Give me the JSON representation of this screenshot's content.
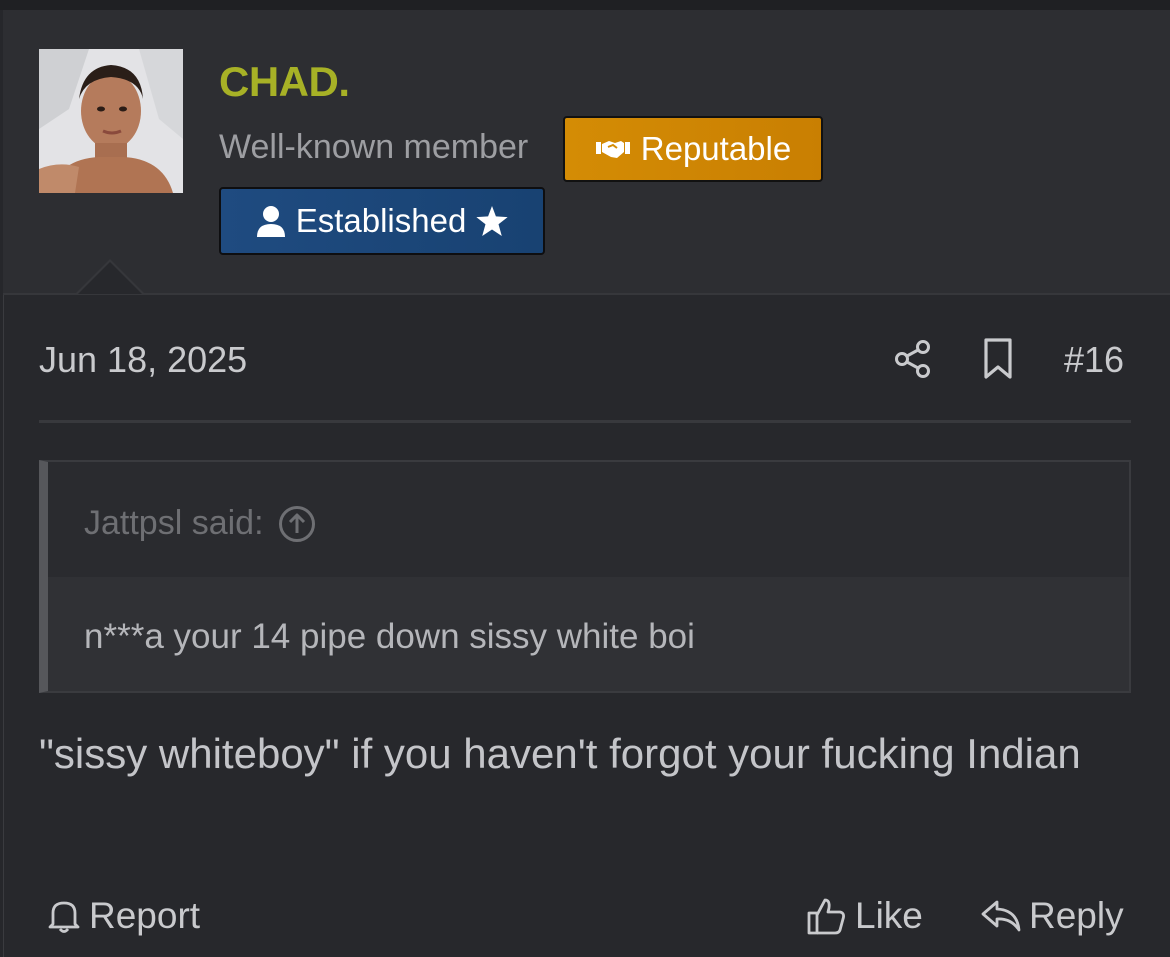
{
  "user": {
    "name": "CHAD.",
    "title": "Well-known member",
    "badges": [
      {
        "label": "Reputable",
        "icon": "handshake-icon",
        "color": "#d48c05"
      },
      {
        "label": "Established",
        "icon": "user-icon",
        "suffix_icon": "star-icon",
        "color": "#1f4b80"
      }
    ],
    "name_color": "#a7b126"
  },
  "post": {
    "date": "Jun 18, 2025",
    "number": "#16",
    "icons": [
      "share-icon",
      "bookmark-icon"
    ],
    "quote": {
      "author_label": "Jattpsl said:",
      "author_icon": "arrow-up-circle-icon",
      "text": "n***a your 14 pipe down sissy white boi"
    },
    "message": "\"sissy whiteboy\" if you haven't forgot your fucking Indian"
  },
  "actions": {
    "report": "Report",
    "like": "Like",
    "reply": "Reply"
  }
}
